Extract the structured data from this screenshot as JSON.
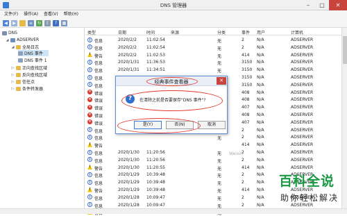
{
  "window": {
    "title": "DNS 管理器",
    "controls": [
      "–",
      "□",
      "✕"
    ]
  },
  "menu": [
    "文件(F)",
    "操作(A)",
    "查看(V)",
    "帮助(H)"
  ],
  "toolbar": [
    "back-arrow-icon",
    "forward-arrow-icon",
    "folder-icon",
    "list-icon",
    "refresh-icon",
    "export-icon",
    "help-icon",
    "properties-icon"
  ],
  "tree": {
    "items": [
      {
        "label": "DNS",
        "indent": 0
      },
      {
        "label": "ADSERVER",
        "indent": 1
      },
      {
        "label": "全局日志",
        "indent": 2
      },
      {
        "label": "DNS 事件",
        "indent": 3
      },
      {
        "label": "DNS 事件 1",
        "indent": 3
      },
      {
        "label": "正向查找区域",
        "indent": 2
      },
      {
        "label": "反向查找区域",
        "indent": 2
      },
      {
        "label": "信任点",
        "indent": 2
      },
      {
        "label": "条件转发器",
        "indent": 2
      }
    ]
  },
  "columns": [
    "类型",
    "日期",
    "时间",
    "来源",
    "分类",
    "事件",
    "用户",
    "计算机"
  ],
  "rows": [
    {
      "type": "信息",
      "level": "info",
      "date": "2020/2/2",
      "time": "11:02:54",
      "category": "无",
      "event": "2",
      "user": "N/A",
      "computer": "ADSERVER"
    },
    {
      "type": "信息",
      "level": "info",
      "date": "2020/2/2",
      "time": "11:02:54",
      "category": "无",
      "event": "2",
      "user": "N/A",
      "computer": "ADSERVER"
    },
    {
      "type": "警告",
      "level": "warn",
      "date": "2020/2/2",
      "time": "11:02:53",
      "category": "无",
      "event": "414",
      "user": "N/A",
      "computer": "ADSERVER"
    },
    {
      "type": "信息",
      "level": "info",
      "date": "2020/1/31",
      "time": "11:36:53",
      "category": "无",
      "event": "3150",
      "user": "N/A",
      "computer": "ADSERVER"
    },
    {
      "type": "信息",
      "level": "info",
      "date": "2020/1/31",
      "time": "11:34:51",
      "category": "无",
      "event": "3150",
      "user": "N/A",
      "computer": "ADSERVER"
    },
    {
      "type": "信息",
      "level": "info",
      "date": "",
      "time": "",
      "category": "无",
      "event": "3150",
      "user": "N/A",
      "computer": "ADSERVER"
    },
    {
      "type": "信息",
      "level": "info",
      "date": "",
      "time": "",
      "category": "无",
      "event": "3150",
      "user": "N/A",
      "computer": "ADSERVER"
    },
    {
      "type": "错误",
      "level": "err",
      "date": "",
      "time": "",
      "category": "无",
      "event": "408",
      "user": "N/A",
      "computer": "ADSERVER"
    },
    {
      "type": "错误",
      "level": "err",
      "date": "",
      "time": "",
      "category": "无",
      "event": "408",
      "user": "N/A",
      "computer": "ADSERVER"
    },
    {
      "type": "错误",
      "level": "err",
      "date": "",
      "time": "",
      "category": "无",
      "event": "407",
      "user": "N/A",
      "computer": "ADSERVER"
    },
    {
      "type": "错误",
      "level": "err",
      "date": "",
      "time": "",
      "category": "无",
      "event": "408",
      "user": "N/A",
      "computer": "ADSERVER"
    },
    {
      "type": "错误",
      "level": "err",
      "date": "",
      "time": "",
      "category": "无",
      "event": "407",
      "user": "N/A",
      "computer": "ADSERVER"
    },
    {
      "type": "信息",
      "level": "info",
      "date": "",
      "time": "",
      "category": "无",
      "event": "2",
      "user": "N/A",
      "computer": "ADSERVER"
    },
    {
      "type": "信息",
      "level": "info",
      "date": "",
      "time": "",
      "category": "无",
      "event": "2",
      "user": "N/A",
      "computer": "ADSERVER"
    },
    {
      "type": "警告",
      "level": "warn",
      "date": "",
      "time": "",
      "category": "",
      "event": "414",
      "user": "N/A",
      "computer": "ADSERVER"
    },
    {
      "type": "信息",
      "level": "info",
      "date": "2020/1/30",
      "time": "11:20:56",
      "category": "无",
      "event": "2",
      "user": "N/A",
      "computer": "ADSERVER"
    },
    {
      "type": "信息",
      "level": "info",
      "date": "2020/1/30",
      "time": "11:20:56",
      "category": "无",
      "event": "2",
      "user": "N/A",
      "computer": "ADSERVER"
    },
    {
      "type": "警告",
      "level": "warn",
      "date": "2020/1/30",
      "time": "11:20:55",
      "category": "无",
      "event": "414",
      "user": "N/A",
      "computer": "ADSERVER"
    },
    {
      "type": "信息",
      "level": "info",
      "date": "2020/1/29",
      "time": "10:39:48",
      "category": "无",
      "event": "2",
      "user": "N/A",
      "computer": "ADSERVER"
    },
    {
      "type": "信息",
      "level": "info",
      "date": "2020/1/29",
      "time": "10:39:48",
      "category": "无",
      "event": "2",
      "user": "N/A",
      "computer": "ADSERVER"
    },
    {
      "type": "警告",
      "level": "warn",
      "date": "2020/1/29",
      "time": "10:39:48",
      "category": "无",
      "event": "414",
      "user": "N/A",
      "computer": "ADSERVER"
    },
    {
      "type": "信息",
      "level": "info",
      "date": "2020/1/28",
      "time": "10:09:47",
      "category": "无",
      "event": "2",
      "user": "N/A",
      "computer": "ADSERVER"
    },
    {
      "type": "信息",
      "level": "info",
      "date": "2020/1/28",
      "time": "10:09:47",
      "category": "无",
      "event": "2",
      "user": "N/A",
      "computer": "ADSERVER"
    },
    {
      "type": "警告",
      "level": "warn",
      "date": "2020/1/28",
      "time": "10:09:46",
      "category": "无",
      "event": "414",
      "user": "N/A",
      "computer": "ADSERVER"
    }
  ],
  "dialog": {
    "title": "经典事件查看器",
    "message": "在清除之前是否要保存\"DNS 事件\"?",
    "buttons": {
      "yes": "是(Y)",
      "no": "否(N)",
      "cancel": "取消"
    },
    "close": "✕"
  },
  "watermark": {
    "brand": "百科全说",
    "tagline": "助你轻松解决",
    "faint": "Weixin"
  },
  "colors": {
    "accent": "#3a7bd5",
    "annotation": "#e23a2c",
    "brand_green": "#1a9a42",
    "error": "#d8382b",
    "warning": "#f3c200"
  }
}
